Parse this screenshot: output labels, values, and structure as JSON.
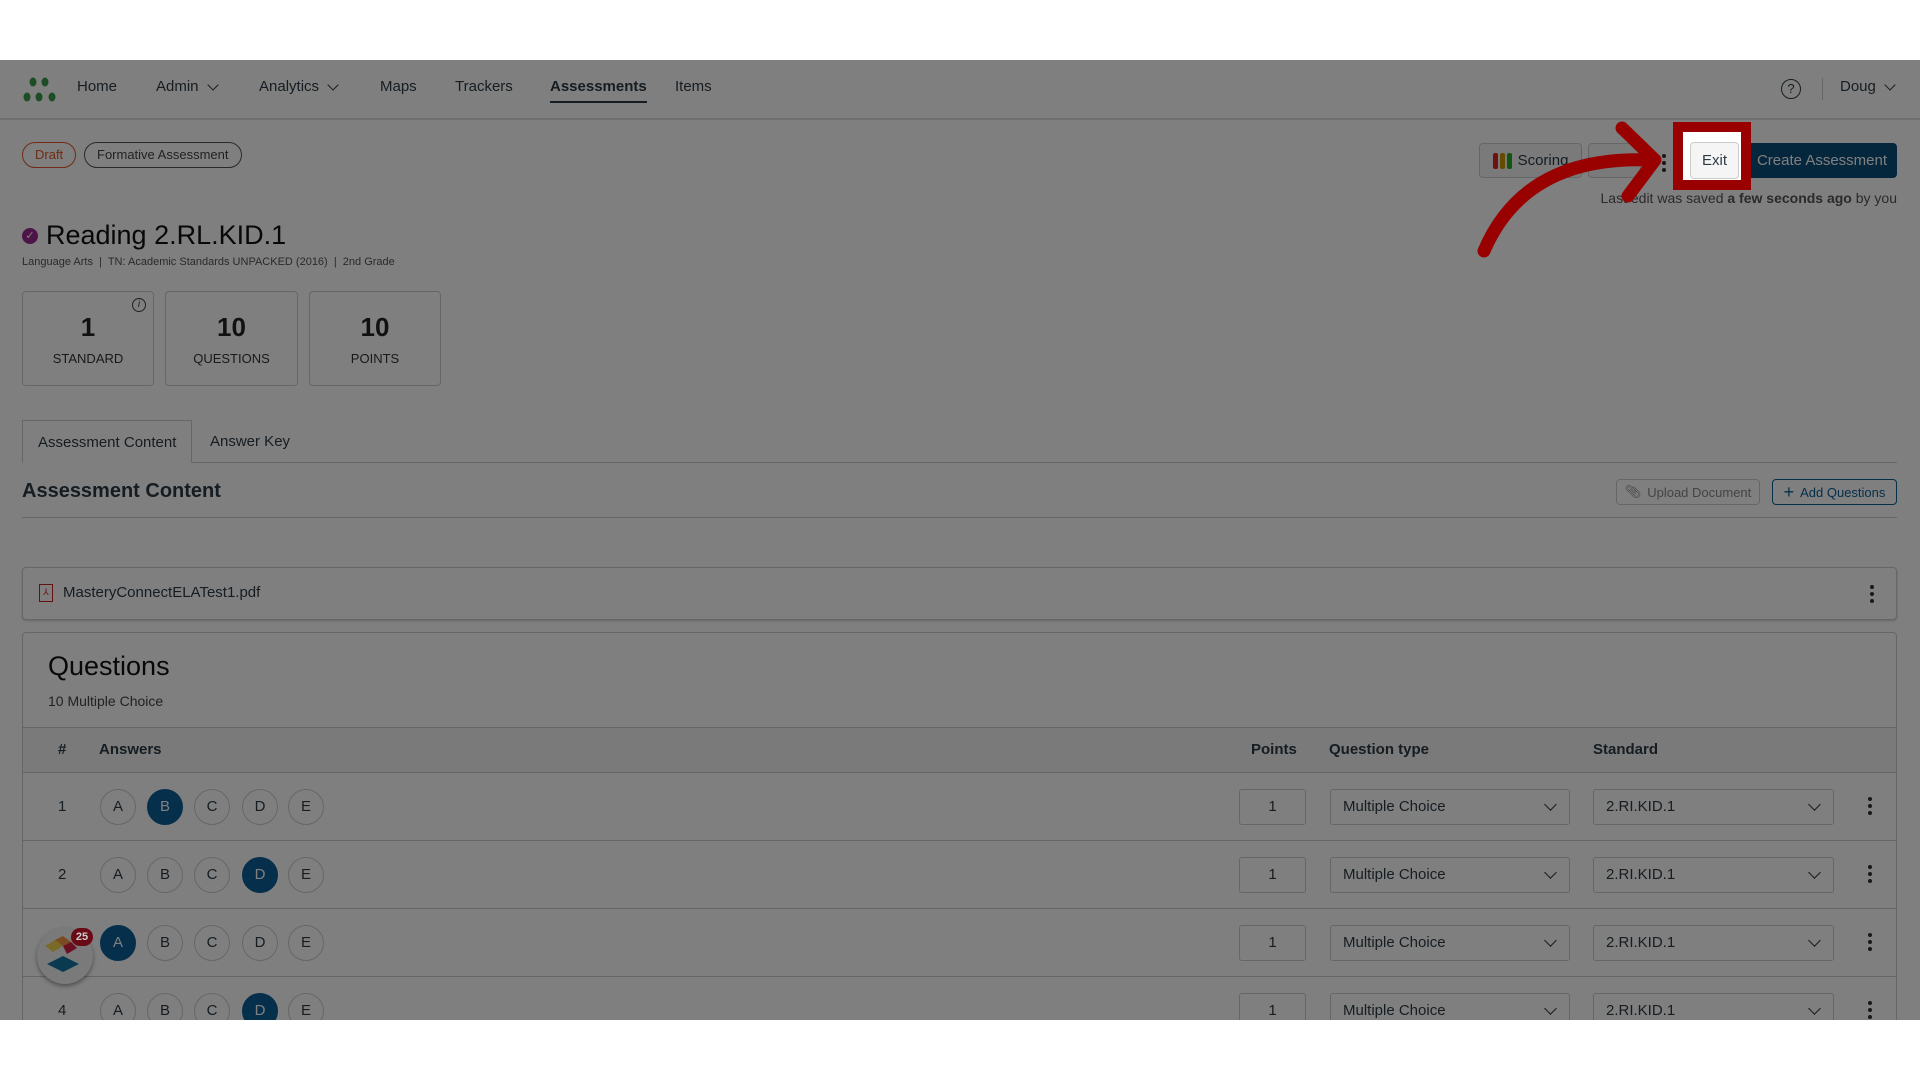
{
  "nav": {
    "items": [
      {
        "label": "Home"
      },
      {
        "label": "Admin",
        "dropdown": true
      },
      {
        "label": "Analytics",
        "dropdown": true
      },
      {
        "label": "Maps"
      },
      {
        "label": "Trackers"
      },
      {
        "label": "Assessments",
        "active": true
      },
      {
        "label": "Items"
      }
    ],
    "help_icon": "?",
    "user": "Doug"
  },
  "badges": {
    "status": "Draft",
    "type": "Formative Assessment"
  },
  "toolbar": {
    "scoring": "Scoring",
    "exit": "Exit",
    "create": "Create Assessment",
    "last_edit_prefix": "Last edit was saved ",
    "last_edit_time": "a few seconds ago",
    "last_edit_suffix": " by you"
  },
  "assessment": {
    "title": "Reading 2.RL.KID.1",
    "subtitle": "Language Arts  |  TN: Academic Standards UNPACKED (2016)  |  2nd Grade"
  },
  "stats": [
    {
      "value": "1",
      "label": "STANDARD"
    },
    {
      "value": "10",
      "label": "QUESTIONS"
    },
    {
      "value": "10",
      "label": "POINTS"
    }
  ],
  "tabs": [
    {
      "label": "Assessment Content",
      "active": true
    },
    {
      "label": "Answer Key"
    }
  ],
  "content": {
    "heading": "Assessment Content",
    "upload": "Upload Document",
    "add": "Add Questions",
    "file": "MasteryConnectELATest1.pdf"
  },
  "questions": {
    "heading": "Questions",
    "summary": "10 Multiple Choice",
    "columns": {
      "num": "#",
      "answers": "Answers",
      "points": "Points",
      "type": "Question type",
      "standard": "Standard"
    },
    "choices": [
      "A",
      "B",
      "C",
      "D",
      "E"
    ],
    "rows": [
      {
        "num": "1",
        "selected": "B",
        "points": "1",
        "type": "Multiple Choice",
        "standard": "2.RI.KID.1"
      },
      {
        "num": "2",
        "selected": "D",
        "points": "1",
        "type": "Multiple Choice",
        "standard": "2.RI.KID.1"
      },
      {
        "num": "3",
        "selected": "A",
        "points": "1",
        "type": "Multiple Choice",
        "standard": "2.RI.KID.1"
      },
      {
        "num": "4",
        "selected": "D",
        "points": "1",
        "type": "Multiple Choice",
        "standard": "2.RI.KID.1"
      }
    ]
  },
  "widget": {
    "badge": "25"
  },
  "colors": {
    "accent": "#0b5e94",
    "create_button": "#0b4f7a",
    "annotation": "#990000",
    "draft": "#e0552b"
  }
}
